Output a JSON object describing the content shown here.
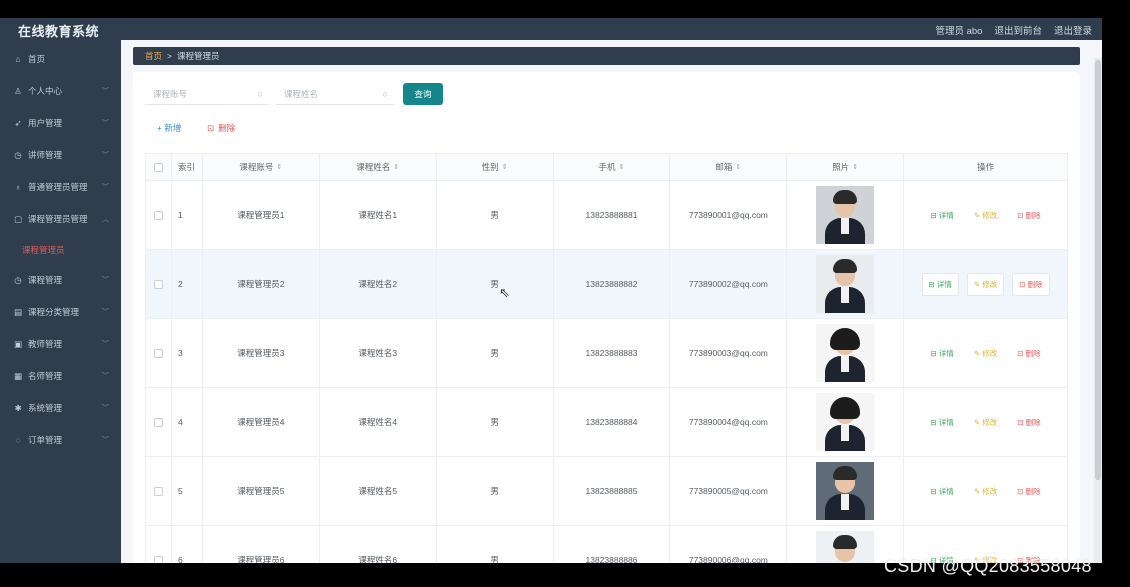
{
  "header": {
    "app_title": "在线教育系统",
    "user_label": "管理员 abo",
    "back_to_front": "退出到前台",
    "logout": "退出登录"
  },
  "sidebar": {
    "items": [
      {
        "label": "首页",
        "icon": "home-icon",
        "glyph": "⌂",
        "expandable": false
      },
      {
        "label": "个人中心",
        "icon": "user-icon",
        "glyph": "♙",
        "expandable": true
      },
      {
        "label": "用户管理",
        "icon": "send-icon",
        "glyph": "➶",
        "expandable": true
      },
      {
        "label": "讲师管理",
        "icon": "clock-icon",
        "glyph": "◷",
        "expandable": true
      },
      {
        "label": "普通管理员管理",
        "icon": "microphone-icon",
        "glyph": "♁",
        "expandable": true
      },
      {
        "label": "课程管理员管理",
        "icon": "tablet-icon",
        "glyph": "▢",
        "expandable": true,
        "expanded": true
      },
      {
        "label": "课程管理",
        "icon": "clock-icon",
        "glyph": "◷",
        "expandable": true
      },
      {
        "label": "课程分类管理",
        "icon": "trash-icon",
        "glyph": "▤",
        "expandable": true
      },
      {
        "label": "教师管理",
        "icon": "image-icon",
        "glyph": "▣",
        "expandable": true
      },
      {
        "label": "名师管理",
        "icon": "list-icon",
        "glyph": "▦",
        "expandable": true
      },
      {
        "label": "系统管理",
        "icon": "gear-icon",
        "glyph": "✱",
        "expandable": true
      },
      {
        "label": "订单管理",
        "icon": "orders-icon",
        "glyph": "◌",
        "expandable": true
      }
    ],
    "active_sub": "课程管理员"
  },
  "breadcrumb": {
    "home": "首页",
    "separator": ">",
    "current": "课程管理员"
  },
  "search": {
    "account_placeholder": "课程账号",
    "name_placeholder": "课程姓名",
    "query_button": "查询"
  },
  "actions": {
    "add": "+ 新增",
    "delete": "删除"
  },
  "table": {
    "headers": [
      "索引",
      "课程账号",
      "课程姓名",
      "性别",
      "手机",
      "邮箱",
      "照片",
      "操作"
    ],
    "rows": [
      {
        "index": "1",
        "account": "课程管理员1",
        "name": "课程姓名1",
        "gender": "男",
        "phone": "13823888881",
        "email": "773890001@qq.com"
      },
      {
        "index": "2",
        "account": "课程管理员2",
        "name": "课程姓名2",
        "gender": "男",
        "phone": "13823888882",
        "email": "773890002@qq.com"
      },
      {
        "index": "3",
        "account": "课程管理员3",
        "name": "课程姓名3",
        "gender": "男",
        "phone": "13823888883",
        "email": "773890003@qq.com"
      },
      {
        "index": "4",
        "account": "课程管理员4",
        "name": "课程姓名4",
        "gender": "男",
        "phone": "13823888884",
        "email": "773890004@qq.com"
      },
      {
        "index": "5",
        "account": "课程管理员5",
        "name": "课程姓名5",
        "gender": "男",
        "phone": "13823888885",
        "email": "773890005@qq.com"
      },
      {
        "index": "6",
        "account": "课程管理员6",
        "name": "课程姓名6",
        "gender": "男",
        "phone": "13823888886",
        "email": "773890006@qq.com"
      }
    ],
    "op_labels": {
      "detail": "详情",
      "edit": "修改",
      "remove": "删除"
    }
  },
  "watermark": "CSDN @QQ2083558048",
  "colors": {
    "sidebar_bg": "#2f3d4c",
    "query_button": "#17858c",
    "accent_red": "#e05a5a",
    "link_blue": "#3d87d9"
  }
}
